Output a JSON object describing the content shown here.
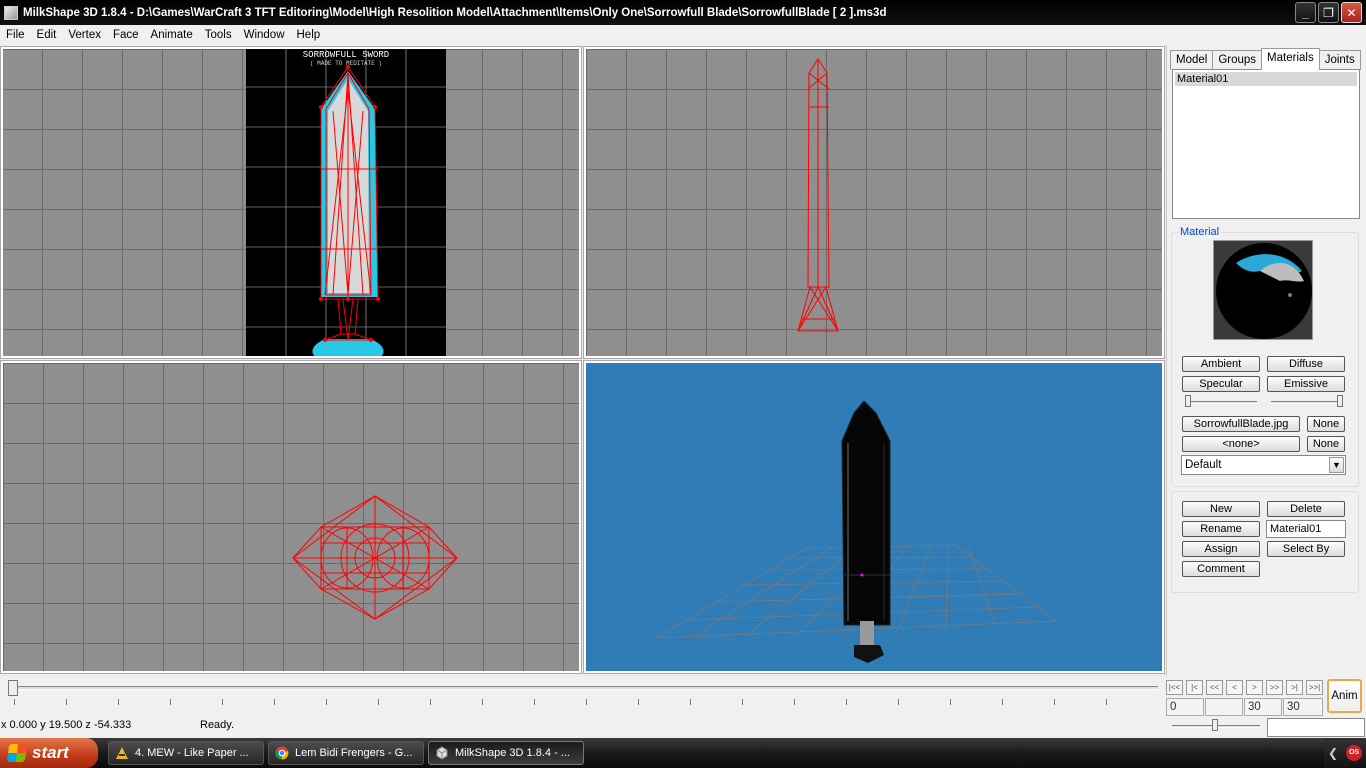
{
  "window": {
    "title": "MilkShape 3D 1.8.4 - D:\\Games\\WarCraft 3 TFT Editoring\\Model\\High Resolition Model\\Attachment\\Items\\Only One\\Sorrowfull Blade\\SorrowfullBlade [ 2 ].ms3d",
    "minimize": "_",
    "maximize": "❐",
    "close": "✕"
  },
  "menu": [
    "File",
    "Edit",
    "Vertex",
    "Face",
    "Animate",
    "Tools",
    "Window",
    "Help"
  ],
  "viewport_texture": {
    "line1": "SORROWFULL SWORD",
    "line2": "( MADE TO MEDITATE )"
  },
  "panel": {
    "tabs": [
      "Model",
      "Groups",
      "Materials",
      "Joints"
    ],
    "active_tab": "Materials",
    "materials": [
      "Material01"
    ],
    "material_group_label": "Material",
    "buttons": {
      "ambient": "Ambient",
      "diffuse": "Diffuse",
      "specular": "Specular",
      "emissive": "Emissive",
      "texture1": "SorrowfullBlade.jpg",
      "none1": "None",
      "texture2": "<none>",
      "none2": "None",
      "new": "New",
      "delete": "Delete",
      "rename": "Rename",
      "assign": "Assign",
      "select_by": "Select By",
      "comment": "Comment"
    },
    "mode_select": "Default",
    "name_field": "Material01",
    "sliders": {
      "left_level": 0.0,
      "right_level": 1.0
    }
  },
  "timeline": {
    "nav": [
      "|<<",
      "|<",
      "<<",
      "<",
      ">",
      ">>",
      ">|",
      ">>|"
    ],
    "frame_fields": [
      "0",
      "",
      "30",
      "30"
    ],
    "anim_label": "Anim",
    "position": 0.0
  },
  "status": {
    "coords": "x 0.000 y 19.500 z -54.333",
    "message": "Ready."
  },
  "taskbar": {
    "start": "start",
    "tasks": [
      "4. MEW - Like Paper ...",
      "Lem Bidi Frengers - G...",
      "MilkShape 3D 1.8.4 - ..."
    ],
    "tray_badge": "OS"
  },
  "colors": {
    "wireframe": "#ff0000",
    "texture_cyan": "#29c8e6",
    "viewport_grey": "#8f8f8f",
    "persp_blue": "#2f7cb6"
  }
}
